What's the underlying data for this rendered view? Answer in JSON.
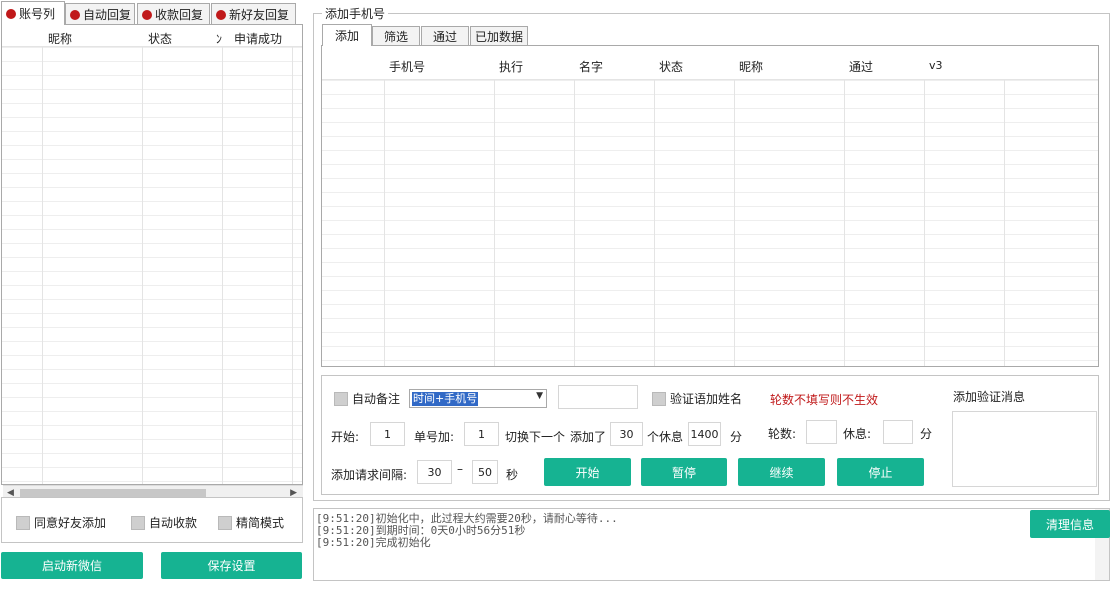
{
  "left_tabs": [
    {
      "label": "账号列",
      "active": true
    },
    {
      "label": "自动回复",
      "active": false
    },
    {
      "label": "收款回复",
      "active": false
    },
    {
      "label": "新好友回复",
      "active": false
    }
  ],
  "account_table": {
    "columns": [
      "昵称",
      "状态",
      "ﾝ",
      "申请成功"
    ]
  },
  "left_options": {
    "accept_friend": "同意好友添加",
    "auto_collect": "自动收款",
    "simple_mode": "精简模式"
  },
  "left_buttons": {
    "start_wechat": "启动新微信",
    "save_settings": "保存设置"
  },
  "group": {
    "title": "添加手机号"
  },
  "right_tabs": [
    {
      "label": "添加",
      "active": true
    },
    {
      "label": "筛选",
      "active": false
    },
    {
      "label": "通过",
      "active": false
    },
    {
      "label": "已加数据",
      "active": false
    }
  ],
  "phone_table": {
    "columns": [
      "手机号",
      "执行",
      "名字",
      "状态",
      "昵称",
      "通过",
      "v3"
    ]
  },
  "controls": {
    "auto_remark_label": "自动备注",
    "remark_select_value": "时间+手机号",
    "verify_add_name_label": "验证语加姓名",
    "rounds_warning": "轮数不填写则不生效",
    "verify_msg_label": "添加验证消息",
    "start_label": "开始:",
    "start_value": "1",
    "single_add_label": "单号加:",
    "single_add_value": "1",
    "switch_after_label": "切换下一个",
    "added_label": "添加了",
    "added_value": "30",
    "rest_count_label": "个休息",
    "rest_value": "1400",
    "minutes_label": "分",
    "rounds_label": "轮数:",
    "rest_label": "休息:",
    "minutes_label2": "分",
    "interval_label": "添加请求间隔:",
    "interval_min": "30",
    "interval_sep": "–",
    "interval_max": "50",
    "seconds_label": "秒",
    "btn_start": "开始",
    "btn_pause": "暂停",
    "btn_continue": "继续",
    "btn_stop": "停止"
  },
  "log": {
    "lines": [
      "[9:51:20]初始化中，此过程大约需要20秒，请耐心等待...",
      "[9:51:20]到期时间：0天0小时56分51秒",
      "[9:51:20]完成初始化"
    ],
    "clear_button": "清理信息"
  },
  "colors": {
    "accent_green": "#16b392",
    "warning_red": "#c0191a",
    "selection_blue": "#3169c6"
  }
}
